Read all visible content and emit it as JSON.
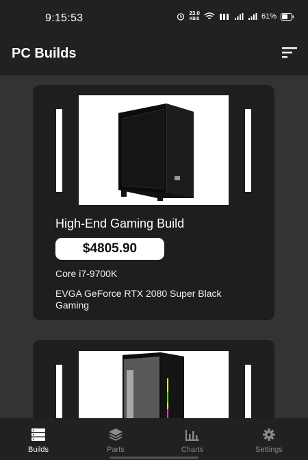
{
  "status_bar": {
    "time": "9:15:53",
    "net_speed_value": "23.0",
    "net_speed_unit": "KB/S",
    "battery": "61%"
  },
  "app_bar": {
    "title": "PC Builds",
    "sort_icon": "sort-icon"
  },
  "builds": [
    {
      "title": "High-End Gaming Build",
      "price": "$4805.90",
      "parts": [
        "Core i7-9700K",
        "EVGA GeForce RTX 2080 Super Black Gaming"
      ]
    }
  ],
  "fab": {
    "icon": "plus-icon"
  },
  "bottom_nav": [
    {
      "label": "Builds",
      "icon": "server-icon",
      "active": true
    },
    {
      "label": "Parts",
      "icon": "layers-icon",
      "active": false
    },
    {
      "label": "Charts",
      "icon": "bar-chart-icon",
      "active": false
    },
    {
      "label": "Settings",
      "icon": "gear-icon",
      "active": false
    }
  ],
  "colors": {
    "accent": "#f4484b",
    "background": "#333333",
    "card": "#1e1e1e",
    "bars": "#212121"
  }
}
